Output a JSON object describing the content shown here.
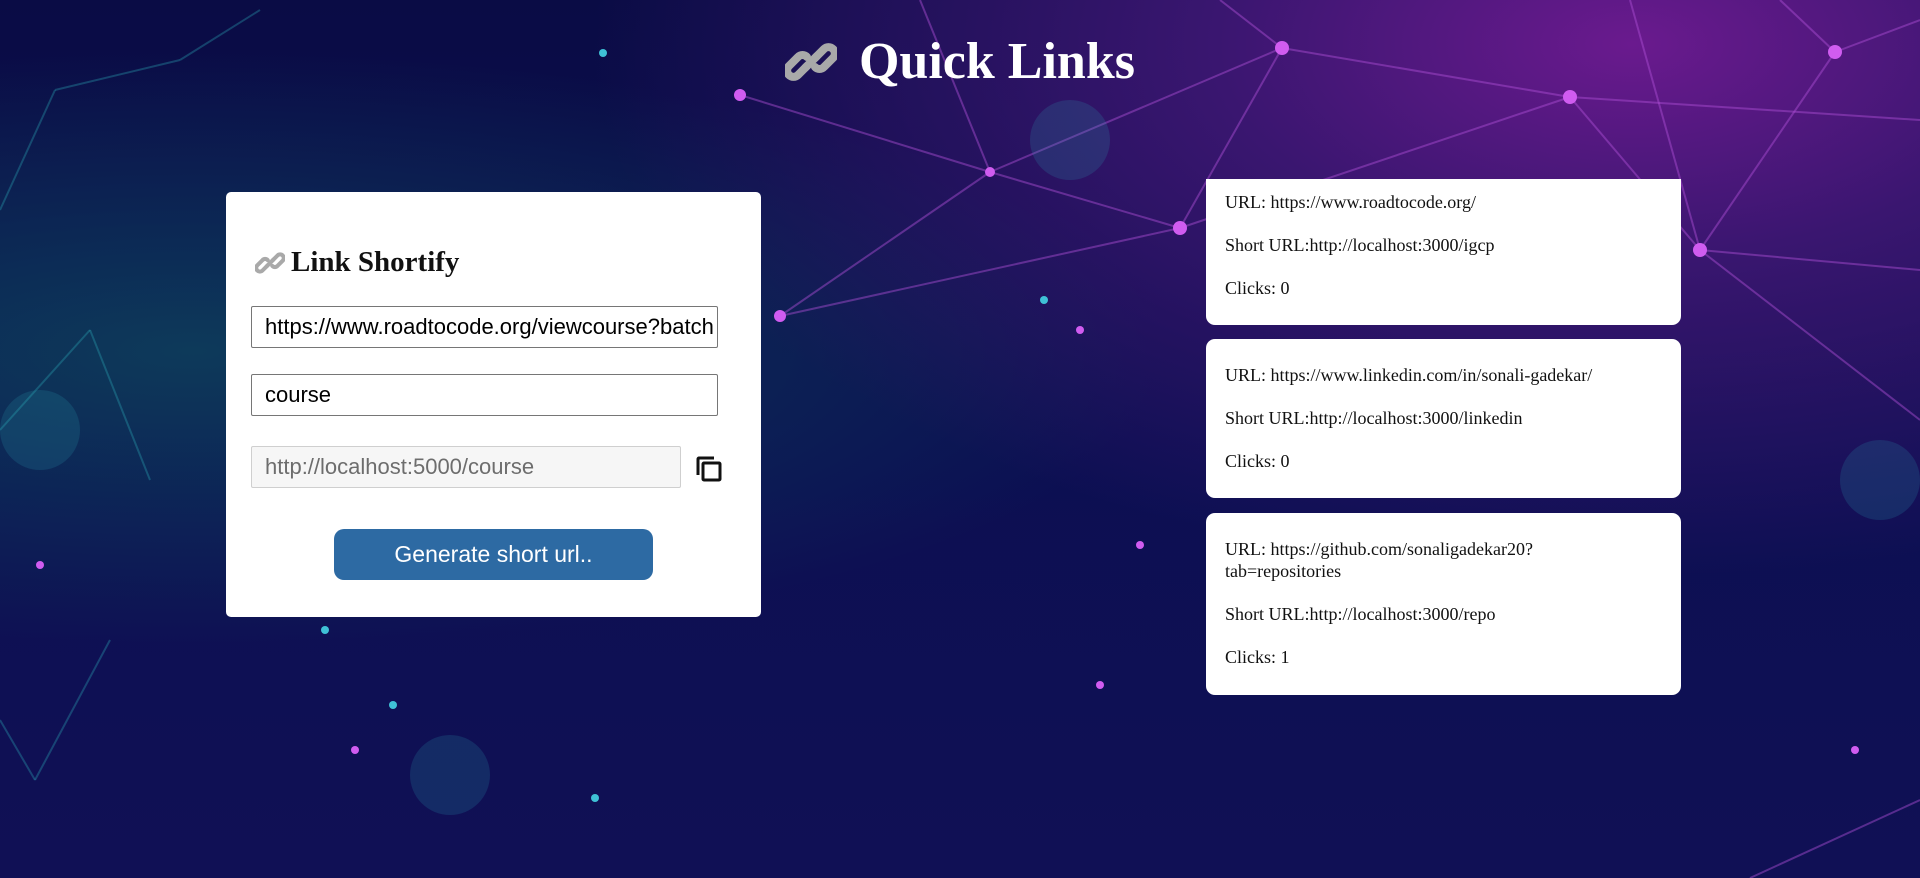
{
  "header": {
    "icon": "link-icon",
    "title": "Quick Links"
  },
  "form": {
    "title": "Link Shortify",
    "title_icon": "link-icon",
    "url_value": "https://www.roadtocode.org/viewcourse?batch",
    "alias_value": "course",
    "result_value": "http://localhost:5000/course",
    "copy_icon": "copy-icon",
    "generate_label": "Generate short url.."
  },
  "links": [
    {
      "url": "URL: https://www.roadtocode.org/",
      "short": "Short URL:http://localhost:3000/igcp",
      "clicks": "Clicks: 0"
    },
    {
      "url": "URL: https://www.linkedin.com/in/sonali-gadekar/",
      "short": "Short URL:http://localhost:3000/linkedin",
      "clicks": "Clicks: 0"
    },
    {
      "url_line1": "URL: https://github.com/sonaligadekar20?",
      "url_line2": "tab=repositories",
      "short": "Short URL:http://localhost:3000/repo",
      "clicks": "Clicks: 1"
    }
  ],
  "colors": {
    "button": "#2d6aa3",
    "card": "#ffffff",
    "background": "#0a0c45"
  }
}
